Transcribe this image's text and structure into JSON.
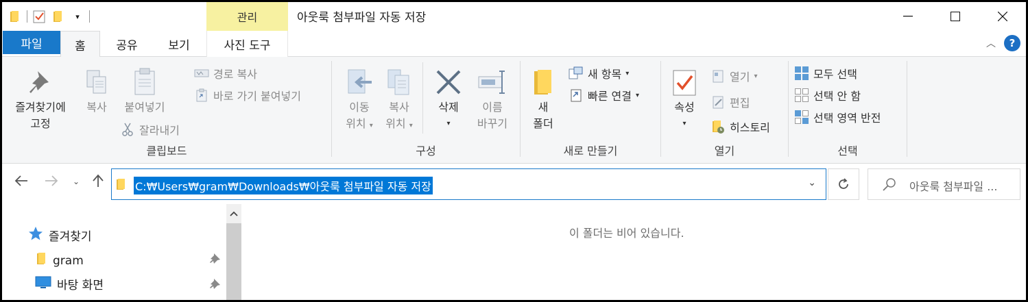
{
  "window": {
    "title": "아웃룩 첨부파일 자동 저장",
    "contextual_tab_group": "관리",
    "controls": {
      "minimize": "—",
      "maximize": "☐",
      "close": "✕"
    }
  },
  "tabs": {
    "file": "파일",
    "home": "홈",
    "share": "공유",
    "view": "보기",
    "photo_tools": "사진 도구"
  },
  "ribbon": {
    "clipboard": {
      "label": "클립보드",
      "pin_line1": "즐겨찾기에",
      "pin_line2": "고정",
      "copy": "복사",
      "paste": "붙여넣기",
      "copy_path": "경로 복사",
      "paste_shortcut": "바로 가기 붙여넣기",
      "cut": "잘라내기"
    },
    "organize": {
      "label": "구성",
      "move_line1": "이동",
      "move_line2": "위치",
      "copyto_line1": "복사",
      "copyto_line2": "위치",
      "delete": "삭제",
      "rename_line1": "이름",
      "rename_line2": "바꾸기"
    },
    "new": {
      "label": "새로 만들기",
      "new_folder_line1": "새",
      "new_folder_line2": "폴더",
      "new_item": "새 항목",
      "easy_access": "빠른 연결"
    },
    "open": {
      "label": "열기",
      "properties": "속성",
      "open": "열기",
      "edit": "편집",
      "history": "히스토리"
    },
    "select": {
      "label": "선택",
      "select_all": "모두 선택",
      "select_none": "선택 안 함",
      "invert": "선택 영역 반전"
    }
  },
  "address": {
    "path": "C:₩Users₩gram₩Downloads₩아웃룩 첨부파일 자동 저장",
    "search_placeholder": "아웃룩 첨부파일 ..."
  },
  "nav": {
    "quick_access": "즐겨찾기",
    "items": [
      {
        "label": "gram",
        "icon": "folder-icon"
      },
      {
        "label": "바탕 화면",
        "icon": "desktop-icon"
      }
    ]
  },
  "content": {
    "empty_message": "이 폴더는 비어 있습니다."
  },
  "colors": {
    "accent": "#1979ca",
    "selection": "#0078d7",
    "contextual": "#f7f1a1",
    "ribbon_bg": "#f5f6f7"
  }
}
